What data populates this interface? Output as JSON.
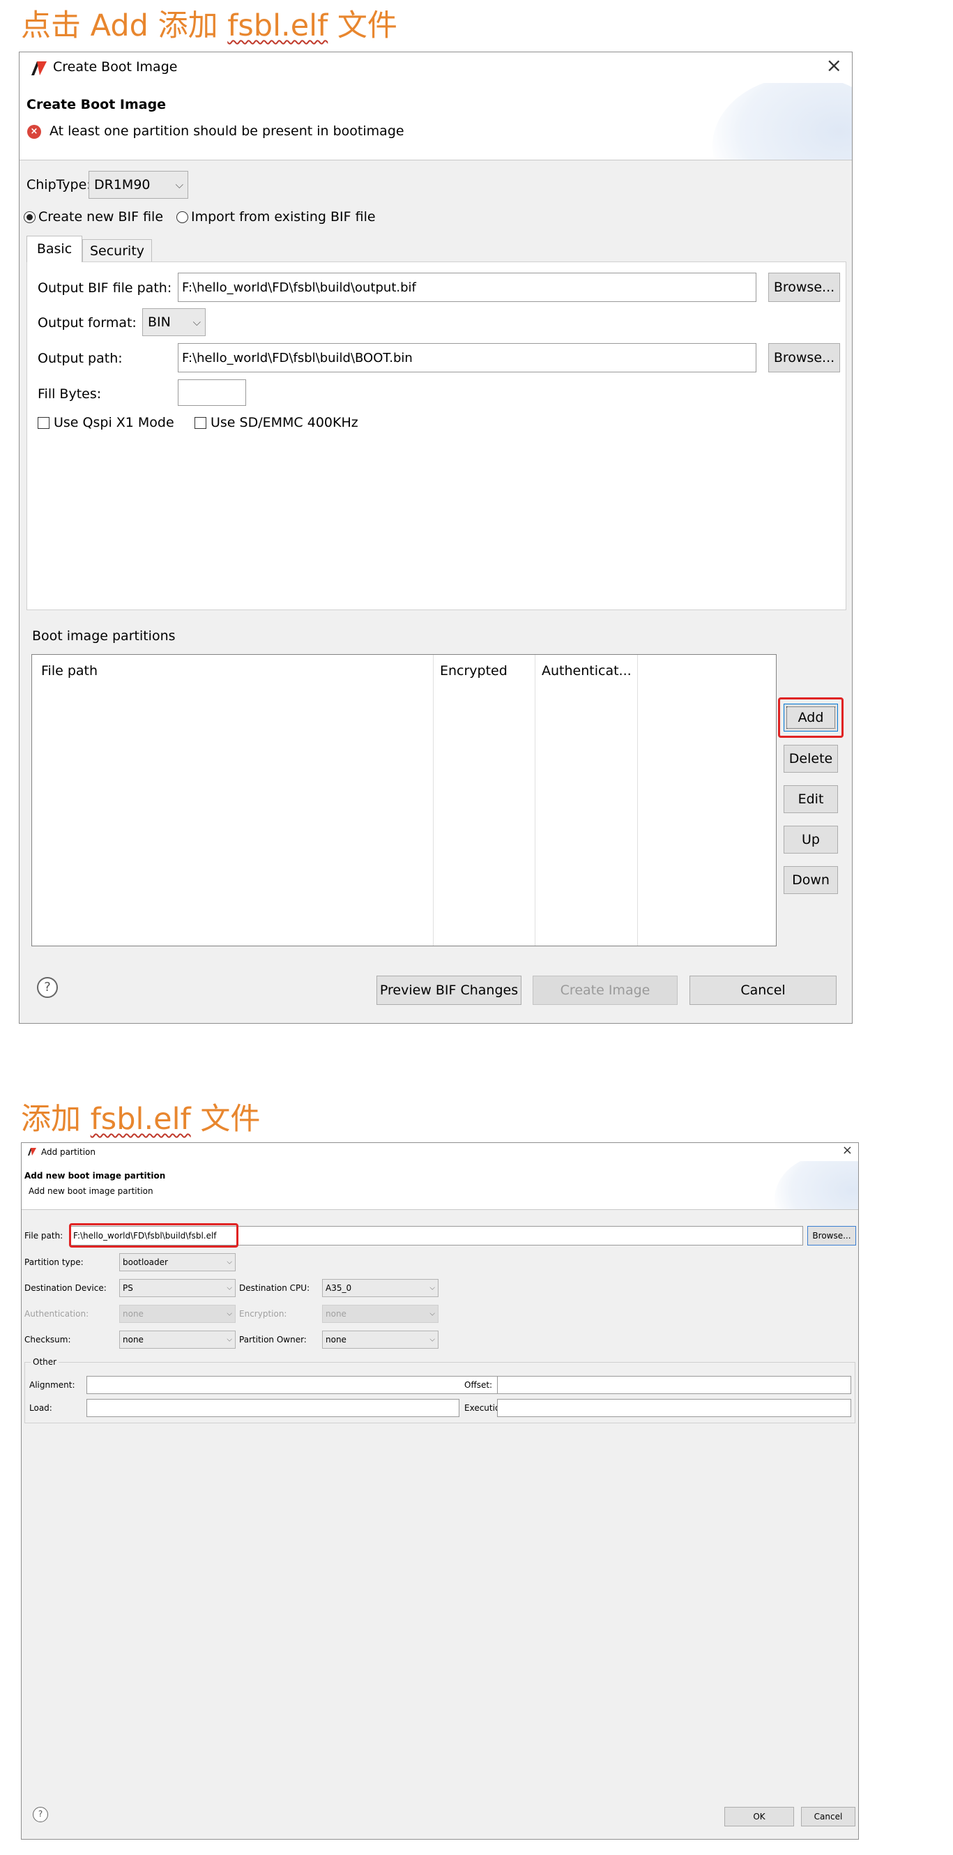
{
  "section1": {
    "heading_prefix": "点击 Add 添加 ",
    "heading_file": "fsbl.elf",
    "heading_suffix": " 文件"
  },
  "dialog1": {
    "window_title": "Create Boot Image",
    "header_title": "Create Boot Image",
    "error_message": "At least one partition should be present in bootimage",
    "chip_type_label": "ChipType:",
    "chip_type_value": "DR1M90",
    "radio_create": "Create new BIF file",
    "radio_import": "Import from existing BIF file",
    "tabs": [
      "Basic",
      "Security"
    ],
    "output_bif_label": "Output BIF file path:",
    "output_bif_value": "F:\\hello_world\\FD\\fsbl\\build\\output.bif",
    "browse_label": "Browse...",
    "output_format_label": "Output format:",
    "output_format_value": "BIN",
    "output_path_label": "Output path:",
    "output_path_value": "F:\\hello_world\\FD\\fsbl\\build\\BOOT.bin",
    "fill_bytes_label": "Fill Bytes:",
    "fill_bytes_value": "",
    "use_qspi_label": "Use Qspi X1 Mode",
    "use_sd_label": "Use SD/EMMC 400KHz",
    "partitions_label": "Boot image partitions",
    "columns": [
      "File path",
      "Encrypted",
      "Authenticat..."
    ],
    "side_buttons": [
      "Add",
      "Delete",
      "Edit",
      "Up",
      "Down"
    ],
    "help": "?",
    "preview_label": "Preview BIF Changes",
    "create_label": "Create Image",
    "cancel_label": "Cancel"
  },
  "section2": {
    "heading_prefix": "添加 ",
    "heading_file": "fsbl.elf",
    "heading_suffix": " 文件"
  },
  "dialog2": {
    "window_title": "Add partition",
    "header_title": "Add new boot image partition",
    "header_subtitle": "Add new boot image partition",
    "file_path_label": "File path:",
    "file_path_value": "F:\\hello_world\\FD\\fsbl\\build\\fsbl.elf",
    "browse_label": "Browse...",
    "partition_type_label": "Partition type:",
    "partition_type_value": "bootloader",
    "dest_device_label": "Destination Device:",
    "dest_device_value": "PS",
    "dest_cpu_label": "Destination CPU:",
    "dest_cpu_value": "A35_0",
    "auth_label": "Authentication:",
    "auth_value": "none",
    "encryption_label": "Encryption:",
    "encryption_value": "none",
    "checksum_label": "Checksum:",
    "checksum_value": "none",
    "owner_label": "Partition Owner:",
    "owner_value": "none",
    "other_label": "Other",
    "alignment_label": "Alignment:",
    "offset_label": "Offset:",
    "load_label": "Load:",
    "execution_label": "Execution:",
    "help": "?",
    "ok_label": "OK",
    "cancel_label": "Cancel"
  },
  "colors": {
    "heading": "#e8862e",
    "highlight": "#e02424",
    "error": "#d9453b"
  }
}
